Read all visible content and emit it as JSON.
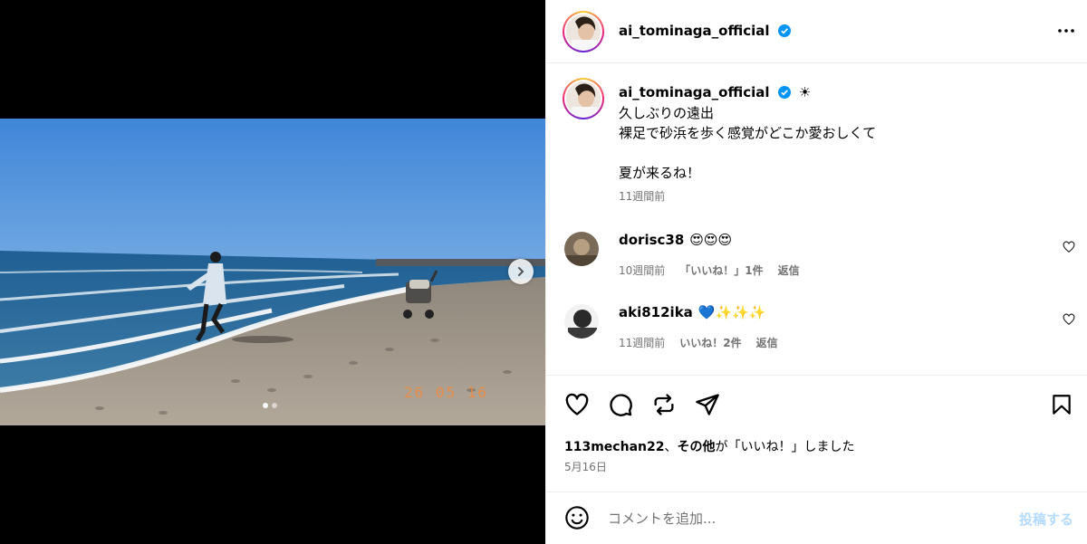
{
  "post": {
    "username": "ai_tominaga_official",
    "verified": true,
    "more_icon": "more-horizontal-icon",
    "media": {
      "date_stamp": "26 05 16",
      "carousel_total": 2,
      "carousel_active": 1,
      "next_icon": "chevron-right-icon"
    },
    "caption": {
      "username": "ai_tominaga_official",
      "sun_emoji": "☀",
      "text": "久しぶりの遠出\n裸足で砂浜を歩く感覚がどこか愛おしくて\n\n夏が来るね！",
      "time": "11週間前"
    },
    "comments": [
      {
        "username": "dorisc38",
        "text": "😍😍😍",
        "time": "10週間前",
        "likes": "「いいね！」1件",
        "reply": "返信"
      },
      {
        "username": "aki812ika",
        "text": "💙✨✨✨",
        "time": "11週間前",
        "likes": "いいね！2件",
        "reply": "返信"
      }
    ],
    "actions": {
      "like_icon": "heart-icon",
      "comment_icon": "comment-bubble-icon",
      "repost_icon": "repost-icon",
      "share_icon": "paper-plane-icon",
      "save_icon": "bookmark-icon"
    },
    "liked_by": {
      "name": "113mechan22",
      "middle": "、",
      "others": "その他",
      "suffix": "が「いいね！」しました"
    },
    "date": "5月16日",
    "comment_box": {
      "placeholder": "コメントを追加...",
      "post_label": "投稿する",
      "emoji_icon": "smiley-icon"
    }
  },
  "colors": {
    "link_disabled": "#b3dbff",
    "meta_gray": "#737373",
    "verified_blue": "#0095f6",
    "border": "#efefef"
  }
}
